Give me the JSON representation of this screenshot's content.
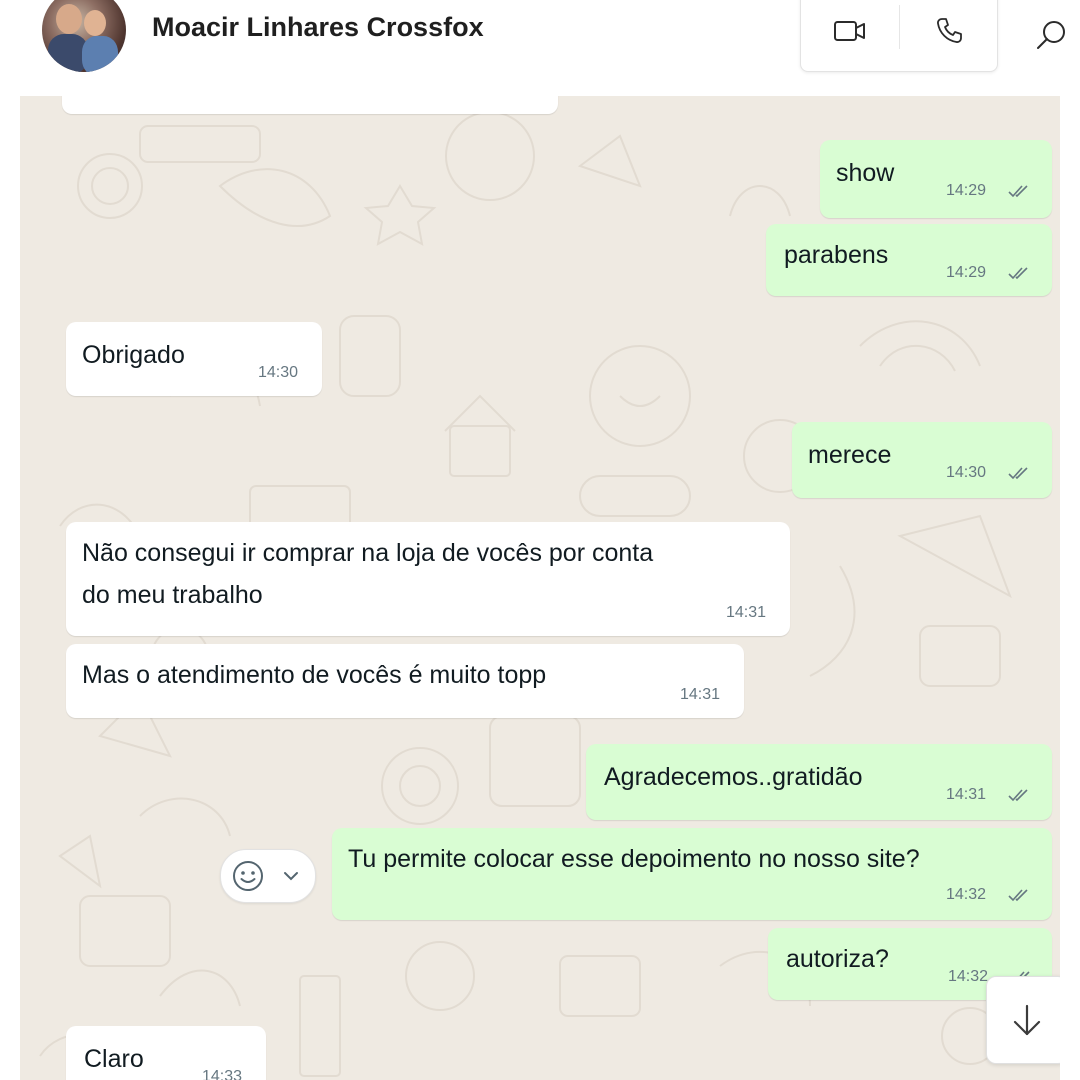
{
  "header": {
    "contact_name": "Moacir Linhares Crossfox",
    "icons": {
      "video": "video-call-icon",
      "voice": "phone-icon",
      "search": "search-icon"
    }
  },
  "messages": [
    {
      "dir": "out",
      "text": "show",
      "time": "14:29",
      "status": "read"
    },
    {
      "dir": "out",
      "text": "parabens",
      "time": "14:29",
      "status": "read"
    },
    {
      "dir": "in",
      "text": "Obrigado",
      "time": "14:30"
    },
    {
      "dir": "out",
      "text": "merece",
      "time": "14:30",
      "status": "read"
    },
    {
      "dir": "in",
      "text": "Não consegui ir comprar na loja de vocês por conta",
      "text2": "do meu trabalho",
      "time": "14:31"
    },
    {
      "dir": "in",
      "text": "Mas o atendimento de vocês é muito topp",
      "time": "14:31"
    },
    {
      "dir": "out",
      "text": "Agradecemos..gratidão",
      "time": "14:31",
      "status": "read"
    },
    {
      "dir": "out",
      "text": "Tu permite colocar esse depoimento no nosso site?",
      "time": "14:32",
      "status": "read"
    },
    {
      "dir": "out",
      "text": "autoriza?",
      "time": "14:32",
      "status": "read"
    },
    {
      "dir": "in",
      "text": "Claro",
      "time": "14:33"
    }
  ],
  "controls": {
    "emoji_reaction_icon": "smiley-icon",
    "scroll_down_icon": "arrow-down-icon"
  },
  "colors": {
    "incoming_bubble": "#ffffff",
    "outgoing_bubble": "#d9fdd3",
    "chat_background": "#efeae2",
    "timestamp": "#667781"
  }
}
